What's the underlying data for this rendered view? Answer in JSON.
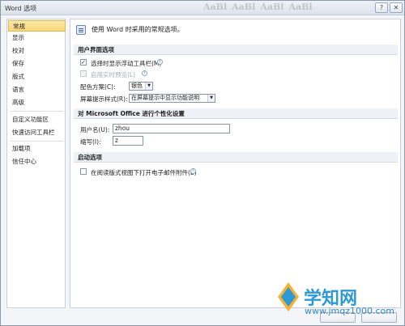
{
  "window": {
    "title": "Word 选项"
  },
  "title_buttons": {
    "help": "?",
    "close": "✕"
  },
  "ribbon_ghost": [
    "AaBl",
    "AaBl",
    "AaBl",
    "AaBl"
  ],
  "nav": {
    "items": [
      {
        "label": "常规",
        "active": true
      },
      {
        "label": "显示"
      },
      {
        "label": "校对"
      },
      {
        "label": "保存"
      },
      {
        "label": "版式"
      },
      {
        "label": "语言"
      },
      {
        "label": "高级"
      },
      {
        "label": "自定义功能区"
      },
      {
        "label": "快速访问工具栏"
      },
      {
        "label": "加载项"
      },
      {
        "label": "信任中心"
      }
    ]
  },
  "main": {
    "header": "使用 Word 时采用的常规选项。",
    "sections": {
      "ui": "用户界面选项",
      "personalize": "对 Microsoft Office 进行个性化设置",
      "startup": "启动选项"
    },
    "ui_options": {
      "show_mini_toolbar": {
        "label": "选择时显示浮动工具栏(M)",
        "checked": true
      },
      "live_preview": {
        "label": "启用实时预览(L)",
        "checked": false,
        "disabled": true
      },
      "color_scheme": {
        "label": "配色方案(C):",
        "value": "银色"
      },
      "screentip_style": {
        "label": "屏幕提示样式(R):",
        "value": "在屏幕提示中显示功能说明"
      }
    },
    "personal": {
      "username": {
        "label": "用户名(U):",
        "value": "zhou"
      },
      "initials": {
        "label": "缩写(I):",
        "value": "z"
      }
    },
    "startup_options": {
      "open_email_reading": {
        "label": "在阅读版式视图下打开电子邮件附件(E)",
        "checked": false
      }
    }
  },
  "watermark": {
    "name": "学知网",
    "url": "www.jmqz1000.com"
  },
  "colors": {
    "accent": "#f9d87a",
    "brand": "#2e9ad5"
  }
}
